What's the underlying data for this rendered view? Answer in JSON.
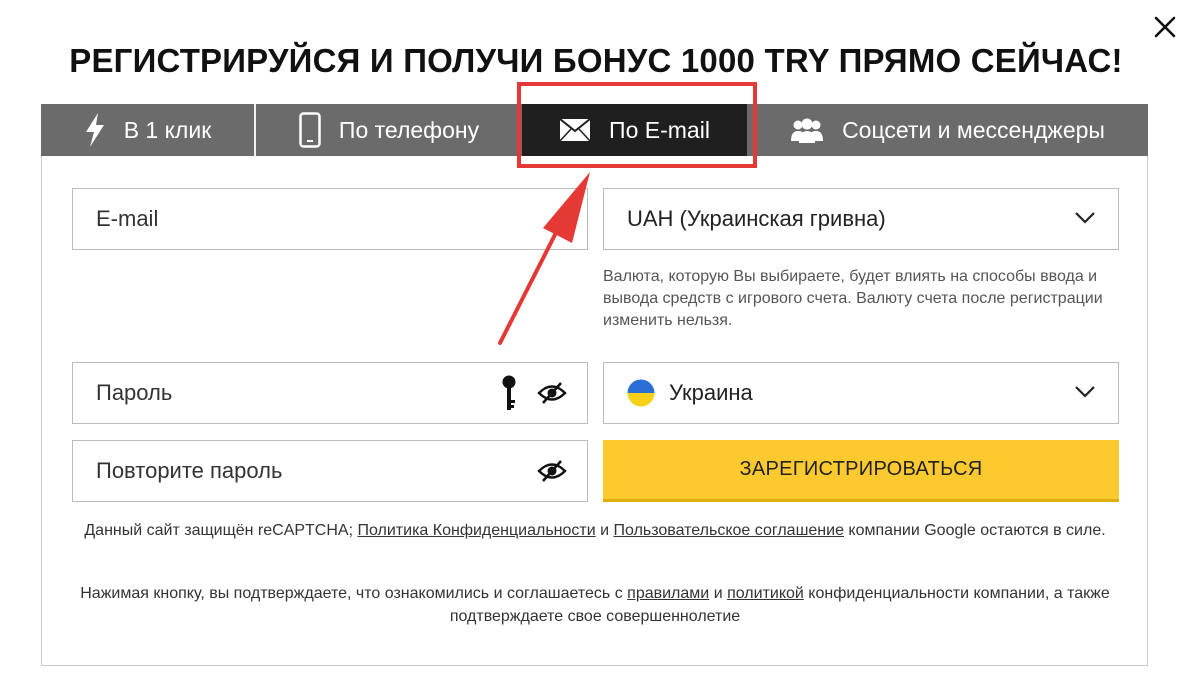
{
  "title": "РЕГИСТРИРУЙСЯ И ПОЛУЧИ БОНУС 1000 TRY ПРЯМО СЕЙЧАС!",
  "tabs": [
    {
      "label": "В 1 клик",
      "icon": "lightning-icon"
    },
    {
      "label": "По телефону",
      "icon": "phone-icon"
    },
    {
      "label": "По E-mail",
      "icon": "envelope-icon",
      "active": true
    },
    {
      "label": "Соцсети и мессенджеры",
      "icon": "users-icon"
    }
  ],
  "form": {
    "email_placeholder": "E-mail",
    "currency_value": "UAH (Украинская гривна)",
    "currency_hint": "Валюта, которую Вы выбираете, будет влиять на способы ввода и вывода средств с игрового счета. Валюту счета после регистрации изменить нельзя.",
    "password_placeholder": "Пароль",
    "repeat_password_placeholder": "Повторите пароль",
    "country_value": "Украина",
    "submit_label": "ЗАРЕГИСТРИРОВАТЬСЯ"
  },
  "legal": {
    "recaptcha_prefix": "Данный сайт защищён reCAPTCHA;",
    "privacy_link": "Политика Конфиденциальности",
    "and": "и",
    "terms_link": "Пользовательское соглашение",
    "recaptcha_suffix": "компании Google остаются в силе.",
    "confirm_prefix": "Нажимая кнопку, вы подтверждаете, что ознакомились и соглашаетесь с",
    "rules_link": "правилами",
    "policy_link": "политикой",
    "confirm_suffix": "конфиденциальности компании, а также подтверждаете свое совершеннолетие"
  },
  "colors": {
    "tab_bar": "#6b6b6b",
    "tab_active": "#1f1f1f",
    "submit": "#fcca2e",
    "annotation": "#e53935"
  }
}
